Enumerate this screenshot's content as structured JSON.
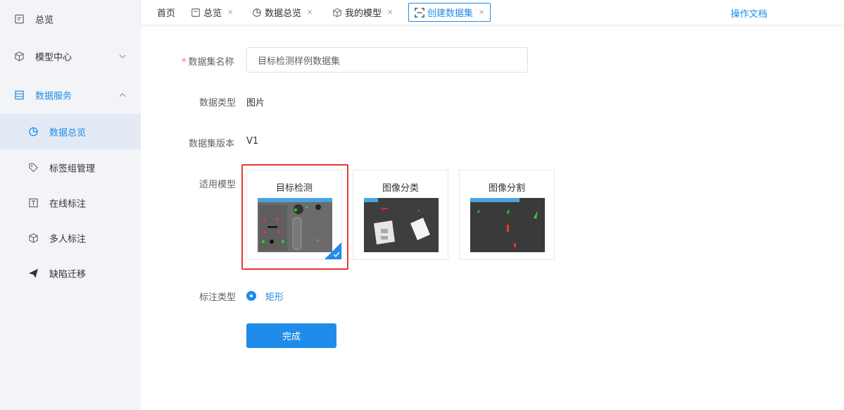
{
  "sidebar": {
    "items": [
      {
        "label": "总览",
        "icon": "overview-icon"
      },
      {
        "label": "模型中心",
        "icon": "cube-icon"
      },
      {
        "label": "数据服务",
        "icon": "database-icon"
      },
      {
        "label": "数据总览",
        "icon": "pie-chart-icon"
      },
      {
        "label": "标签组管理",
        "icon": "tag-icon"
      },
      {
        "label": "在线标注",
        "icon": "text-box-icon"
      },
      {
        "label": "多人标注",
        "icon": "multi-cube-icon"
      },
      {
        "label": "缺陷迁移",
        "icon": "paper-plane-icon"
      }
    ]
  },
  "tabs": {
    "items": [
      {
        "label": "首页"
      },
      {
        "label": "总览",
        "close": "×"
      },
      {
        "label": "数据总览",
        "close": "×"
      },
      {
        "label": "我的模型",
        "close": "×"
      },
      {
        "label": "创建数据集",
        "close": "×"
      }
    ],
    "doc_link": "操作文档"
  },
  "form": {
    "name_label": "数据集名称",
    "required_mark": "*",
    "name_value": "目标检测样例数据集",
    "type_label": "数据类型",
    "type_value": "图片",
    "version_label": "数据集版本",
    "version_value": "V1",
    "model_label": "适用模型",
    "models": [
      {
        "title": "目标检测",
        "selected": true
      },
      {
        "title": "图像分类",
        "selected": false
      },
      {
        "title": "图像分割",
        "selected": false
      }
    ],
    "annotation_label": "标注类型",
    "annotation_option": "矩形",
    "submit_label": "完成"
  },
  "colors": {
    "accent": "#1f8ceb",
    "sidebar_bg": "#f3f4f7",
    "active_item_bg": "#e3eaf5",
    "highlight": "#e53935",
    "required": "#f56c6c"
  }
}
